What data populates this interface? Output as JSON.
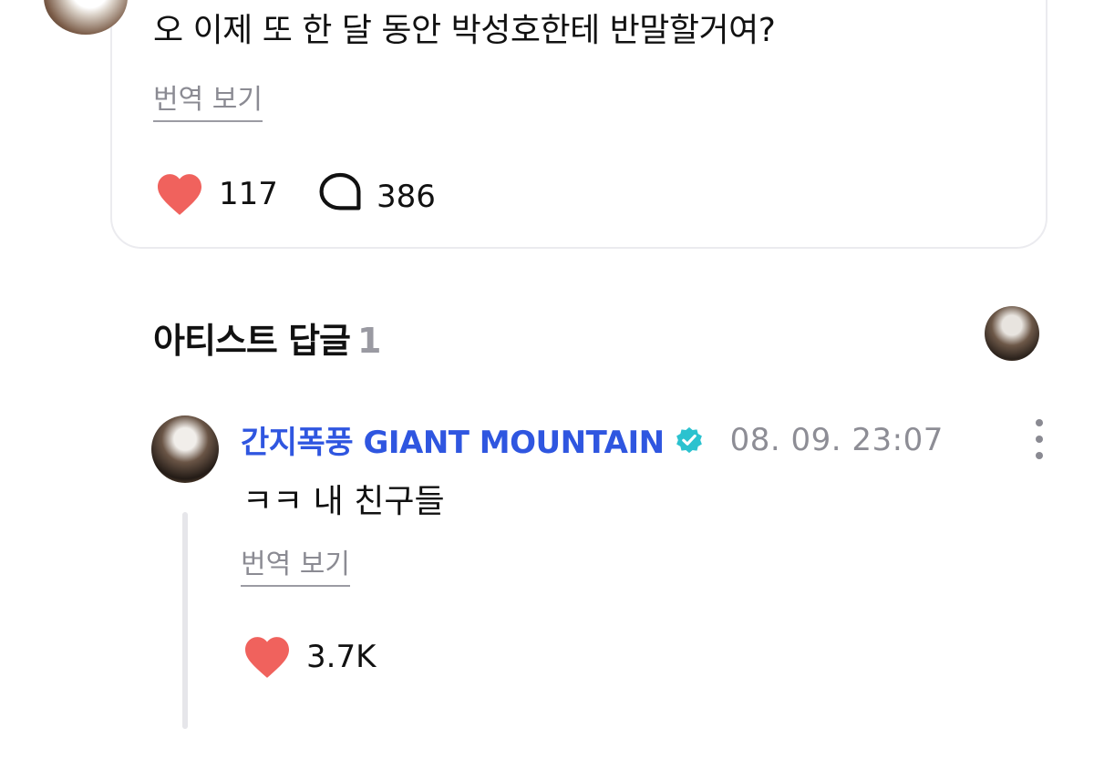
{
  "post": {
    "text": "오 이제 또 한 달 동안 박성호한테 반말할거여?",
    "translate_label": "번역 보기",
    "like_count": "117",
    "comment_count": "386"
  },
  "artist_replies": {
    "title": "아티스트 답글",
    "count": "1"
  },
  "reply": {
    "author": "간지폭풍 GIANT MOUNTAIN",
    "timestamp": "08. 09. 23:07",
    "text": "ㅋㅋ 내 친구들",
    "translate_label": "번역 보기",
    "like_count": "3.7K"
  },
  "icons": {
    "like": "heart-icon",
    "comment": "comment-bubble-icon",
    "verified": "verified-badge-icon",
    "more": "more-vertical-icon"
  },
  "colors": {
    "heart": "#f0625d",
    "author_name": "#2f56e0",
    "verified_badge": "#2bc2cf",
    "muted_text": "#8b8b93"
  }
}
